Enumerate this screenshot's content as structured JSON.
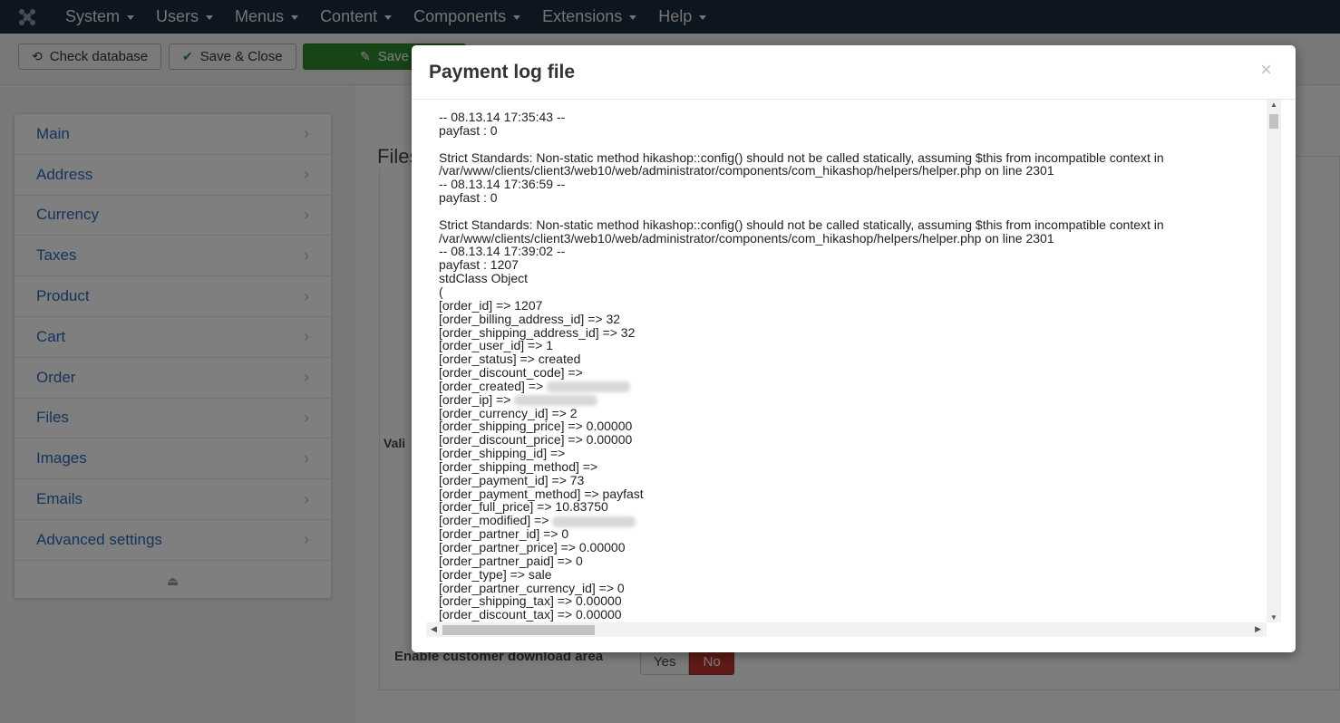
{
  "topnav": {
    "items": [
      "System",
      "Users",
      "Menus",
      "Content",
      "Components",
      "Extensions",
      "Help"
    ]
  },
  "toolbar": {
    "check_database": "Check database",
    "save_close": "Save & Close",
    "save": "Save"
  },
  "sidebar": {
    "items": [
      "Main",
      "Address",
      "Currency",
      "Taxes",
      "Product",
      "Cart",
      "Order",
      "Files",
      "Images",
      "Emails",
      "Advanced settings"
    ]
  },
  "background": {
    "legend": "Files",
    "valid_label": "Vali",
    "enable_label": "Enable customer download area",
    "yes": "Yes",
    "no": "No"
  },
  "modal": {
    "title": "Payment log file",
    "close": "×",
    "log_lines": [
      "-- 08.13.14 17:35:43 --",
      "payfast : 0",
      "",
      "Strict Standards: Non-static method hikashop::config() should not be called statically, assuming $this from incompatible context in",
      "/var/www/clients/client3/web10/web/administrator/components/com_hikashop/helpers/helper.php on line 2301",
      "-- 08.13.14 17:36:59 --",
      "payfast : 0",
      "",
      "Strict Standards: Non-static method hikashop::config() should not be called statically, assuming $this from incompatible context in",
      "/var/www/clients/client3/web10/web/administrator/components/com_hikashop/helpers/helper.php on line 2301",
      "-- 08.13.14 17:39:02 --",
      "payfast : 1207",
      "stdClass Object",
      "(",
      "[order_id] => 1207",
      "[order_billing_address_id] => 32",
      "[order_shipping_address_id] => 32",
      "[order_user_id] => 1",
      "[order_status] => created",
      "[order_discount_code] =>",
      "[order_created] =>",
      "[order_ip] =>",
      "[order_currency_id] => 2",
      "[order_shipping_price] => 0.00000",
      "[order_discount_price] => 0.00000",
      "[order_shipping_id] =>",
      "[order_shipping_method] =>",
      "[order_payment_id] => 73",
      "[order_payment_method] => payfast",
      "[order_full_price] => 10.83750",
      "[order_modified] =>",
      "[order_partner_id] => 0",
      "[order_partner_price] => 0.00000",
      "[order_partner_paid] => 0",
      "[order_type] => sale",
      "[order_partner_currency_id] => 0",
      "[order_shipping_tax] => 0.00000",
      "[order_discount_tax] => 0.00000"
    ]
  }
}
